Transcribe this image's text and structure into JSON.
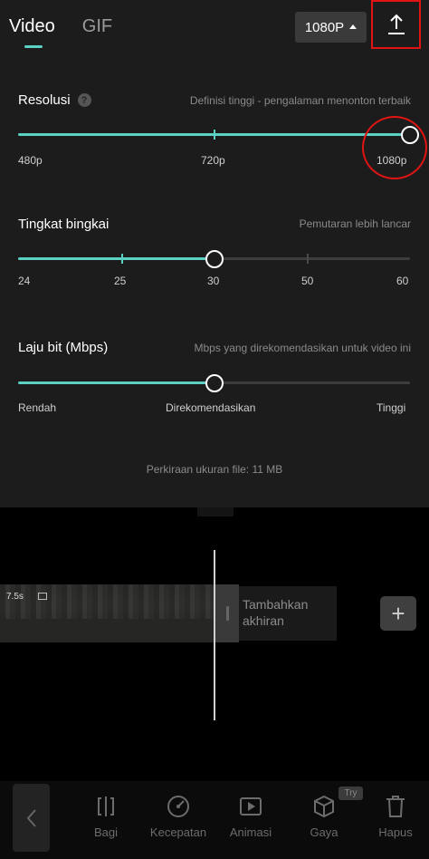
{
  "tabs": [
    {
      "label": "Video",
      "active": true
    },
    {
      "label": "GIF",
      "active": false
    }
  ],
  "resolution_button": {
    "label": "1080P"
  },
  "sections": {
    "resolution": {
      "title": "Resolusi",
      "help": "?",
      "description": "Definisi tinggi - pengalaman menonton terbaik",
      "labels": [
        "480p",
        "720p",
        "1080p"
      ],
      "selected": "1080p"
    },
    "framerate": {
      "title": "Tingkat bingkai",
      "description": "Pemutaran lebih lancar",
      "labels": [
        "24",
        "25",
        "30",
        "50",
        "60"
      ],
      "selected": "30"
    },
    "bitrate": {
      "title": "Laju bit (Mbps)",
      "description": "Mbps yang direkomendasikan untuk video ini",
      "labels": [
        "Rendah",
        "Direkomendasikan",
        "Tinggi"
      ],
      "selected": "Direkomendasikan"
    }
  },
  "estimate": "Perkiraan ukuran file: 11 MB",
  "timeline": {
    "clip_duration": "7.5s",
    "add_ending": "Tambahkan akhiran",
    "add_button": "+"
  },
  "toolbar": {
    "items": [
      {
        "label": "Bagi",
        "icon": "split-icon"
      },
      {
        "label": "Kecepatan",
        "icon": "speed-icon"
      },
      {
        "label": "Animasi",
        "icon": "animation-icon"
      },
      {
        "label": "Gaya",
        "icon": "style-cube-icon"
      },
      {
        "label": "Hapus",
        "icon": "trash-icon"
      }
    ],
    "try_badge": "Try"
  },
  "colors": {
    "accent": "#5ad1c3",
    "panel_bg": "#1c1c1c",
    "highlight": "#e01414"
  }
}
